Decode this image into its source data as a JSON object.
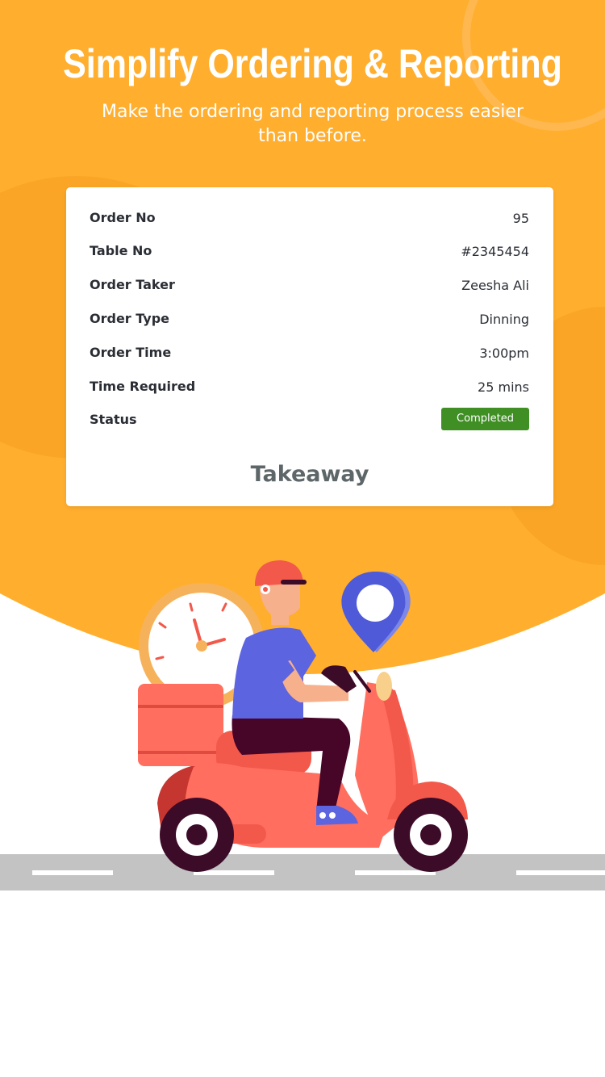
{
  "hero": {
    "title": "Simplify Ordering & Reporting",
    "subtitle": "Make the ordering and reporting process easier than before."
  },
  "order": {
    "rows": [
      {
        "label": "Order No",
        "value": "95"
      },
      {
        "label": "Table No",
        "value": "#2345454"
      },
      {
        "label": "Order Taker",
        "value": "Zeesha Ali"
      },
      {
        "label": "Order Type",
        "value": "Dinning"
      },
      {
        "label": "Order Time",
        "value": "3:00pm"
      },
      {
        "label": "Time Required",
        "value": "25 mins"
      }
    ],
    "status_label": "Status",
    "status_value": "Completed",
    "mode": "Takeaway"
  },
  "colors": {
    "primary": "#FFAE2E",
    "status_green": "#3F8F24",
    "scooter": "#FF5F4B",
    "road": "#C2C3C2",
    "pin": "#4E5AD8"
  },
  "icons": [
    "location-pin-icon",
    "clock-icon",
    "delivery-scooter-icon"
  ]
}
